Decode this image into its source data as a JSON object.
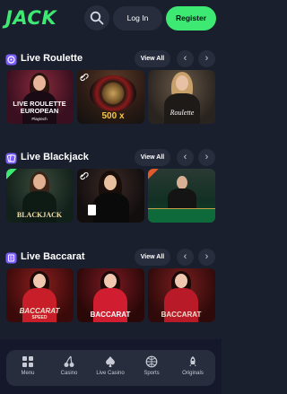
{
  "header": {
    "logo": "JACK",
    "login_label": "Log In",
    "register_label": "Register"
  },
  "sections": [
    {
      "title": "Live Roulette",
      "view_all": "View All",
      "cards": [
        {
          "caption": "LIVE ROULETTE EUROPEAN",
          "subcaption": "Playtech"
        },
        {
          "caption": "500 x",
          "subcaption": ""
        },
        {
          "caption": "Roulette",
          "subcaption": ""
        }
      ]
    },
    {
      "title": "Live Blackjack",
      "view_all": "View All",
      "cards": [
        {
          "caption": "BLACKJACK",
          "subcaption": ""
        },
        {
          "caption": "",
          "subcaption": ""
        },
        {
          "caption": "",
          "subcaption": ""
        }
      ]
    },
    {
      "title": "Live Baccarat",
      "view_all": "View All",
      "cards": [
        {
          "caption": "BACCARAT",
          "subcaption": "SPEED"
        },
        {
          "caption": "BACCARAT",
          "subcaption": ""
        },
        {
          "caption": "BACCARAT",
          "subcaption": ""
        }
      ]
    }
  ],
  "bottom_nav": {
    "items": [
      {
        "label": "Menu",
        "icon": "grid-icon"
      },
      {
        "label": "Casino",
        "icon": "cherries-icon"
      },
      {
        "label": "Live Casino",
        "icon": "spade-icon"
      },
      {
        "label": "Sports",
        "icon": "ball-icon"
      },
      {
        "label": "Originals",
        "icon": "rocket-icon"
      }
    ]
  },
  "colors": {
    "background": "#1a1f2e",
    "surface": "#272d3d",
    "accent": "#3de873",
    "section_icon": "#7b5cff"
  }
}
